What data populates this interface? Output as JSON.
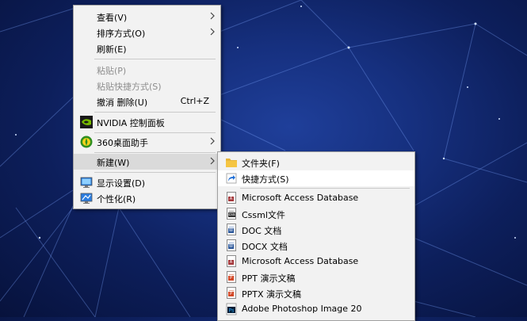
{
  "context_menu": {
    "items": [
      {
        "label": "查看(V)",
        "submenu": true
      },
      {
        "label": "排序方式(O)",
        "submenu": true
      },
      {
        "label": "刷新(E)"
      },
      {
        "label": "粘贴(P)",
        "disabled": true
      },
      {
        "label": "粘贴快捷方式(S)",
        "disabled": true
      },
      {
        "label": "撤消 删除(U)",
        "shortcut": "Ctrl+Z"
      },
      {
        "label": "NVIDIA 控制面板",
        "icon": "nvidia-icon"
      },
      {
        "label": "360桌面助手",
        "icon": "360-desktop-assistant-icon",
        "submenu": true
      },
      {
        "label": "新建(W)",
        "submenu": true,
        "highlighted": true
      },
      {
        "label": "显示设置(D)",
        "icon": "display-settings-icon"
      },
      {
        "label": "个性化(R)",
        "icon": "personalize-icon"
      }
    ]
  },
  "new_submenu": {
    "items": [
      {
        "label": "文件夹(F)",
        "icon": "folder-icon"
      },
      {
        "label": "快捷方式(S)",
        "icon": "shortcut-icon",
        "highlighted": true
      },
      {
        "label": "Microsoft Access Database",
        "icon": "access-database-icon"
      },
      {
        "label": "Cssml文件",
        "icon": "cssml-file-icon"
      },
      {
        "label": "DOC 文档",
        "icon": "doc-file-icon"
      },
      {
        "label": "DOCX 文档",
        "icon": "docx-file-icon"
      },
      {
        "label": "Microsoft Access Database",
        "icon": "access-database-icon"
      },
      {
        "label": "PPT 演示文稿",
        "icon": "ppt-file-icon"
      },
      {
        "label": "PPTX 演示文稿",
        "icon": "pptx-file-icon"
      },
      {
        "label": "Adobe Photoshop Image 20",
        "icon": "photoshop-image-icon"
      }
    ]
  },
  "colors": {
    "menu_background": "#f2f2f2",
    "menu_highlight": "#dadada",
    "disabled_text": "#8d8d8d",
    "desktop_blue": "#16307f",
    "nvidia_green": "#76b900",
    "folder_yellow": "#f5c542",
    "word_blue": "#2b579a",
    "access_red": "#a4373a",
    "powerpoint_orange": "#d24726",
    "photoshop_blue": "#31a8ff"
  }
}
